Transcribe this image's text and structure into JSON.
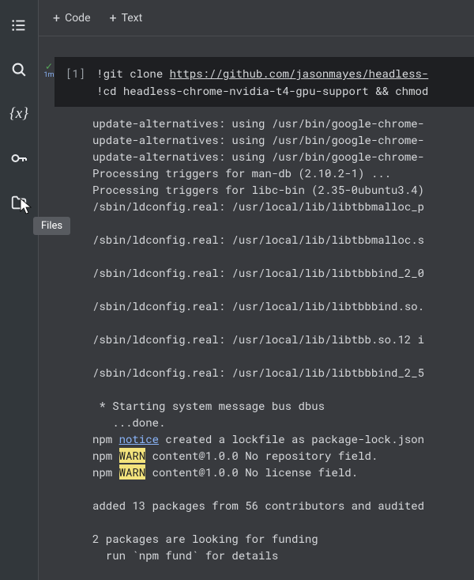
{
  "sidebar": {
    "icons": {
      "toc": "toc-icon",
      "search": "search-icon",
      "vars": "variables-icon",
      "secrets": "key-icon",
      "files": "files-icon"
    },
    "tooltip": "Files"
  },
  "toolbar": {
    "code_label": "Code",
    "text_label": "Text"
  },
  "cell": {
    "status_time": "1m",
    "execution_count": "[1]",
    "code_prefix1": "!git clone ",
    "code_url": "https://github.com/jasonmayes/headless-",
    "code_line2": "!cd headless-chrome-nvidia-t4-gpu-support && chmod"
  },
  "output_lines": [
    {
      "t": "update-alternatives: using /usr/bin/google-chrome-"
    },
    {
      "t": "update-alternatives: using /usr/bin/google-chrome-"
    },
    {
      "t": "update-alternatives: using /usr/bin/google-chrome-"
    },
    {
      "t": "Processing triggers for man-db (2.10.2-1) ..."
    },
    {
      "t": "Processing triggers for libc-bin (2.35-0ubuntu3.4)"
    },
    {
      "t": "/sbin/ldconfig.real: /usr/local/lib/libtbbmalloc_p"
    },
    {
      "t": ""
    },
    {
      "t": "/sbin/ldconfig.real: /usr/local/lib/libtbbmalloc.s"
    },
    {
      "t": ""
    },
    {
      "t": "/sbin/ldconfig.real: /usr/local/lib/libtbbbind_2_0"
    },
    {
      "t": ""
    },
    {
      "t": "/sbin/ldconfig.real: /usr/local/lib/libtbbbind.so."
    },
    {
      "t": ""
    },
    {
      "t": "/sbin/ldconfig.real: /usr/local/lib/libtbb.so.12 i"
    },
    {
      "t": ""
    },
    {
      "t": "/sbin/ldconfig.real: /usr/local/lib/libtbbbind_2_5"
    },
    {
      "t": ""
    },
    {
      "t": " * Starting system message bus dbus"
    },
    {
      "t": "   ...done."
    },
    {
      "seg": [
        {
          "c": "",
          "t": "npm "
        },
        {
          "c": "notice",
          "t": "notice"
        },
        {
          "c": "",
          "t": " created a lockfile as package-lock.json"
        }
      ]
    },
    {
      "seg": [
        {
          "c": "",
          "t": "npm "
        },
        {
          "c": "warn",
          "t": "WARN"
        },
        {
          "c": "",
          "t": " content@1.0.0 No repository field."
        }
      ]
    },
    {
      "seg": [
        {
          "c": "",
          "t": "npm "
        },
        {
          "c": "warn",
          "t": "WARN"
        },
        {
          "c": "",
          "t": " content@1.0.0 No license field."
        }
      ]
    },
    {
      "t": ""
    },
    {
      "t": "added 13 packages from 56 contributors and audited"
    },
    {
      "t": ""
    },
    {
      "t": "2 packages are looking for funding"
    },
    {
      "t": "  run `npm fund` for details"
    }
  ]
}
